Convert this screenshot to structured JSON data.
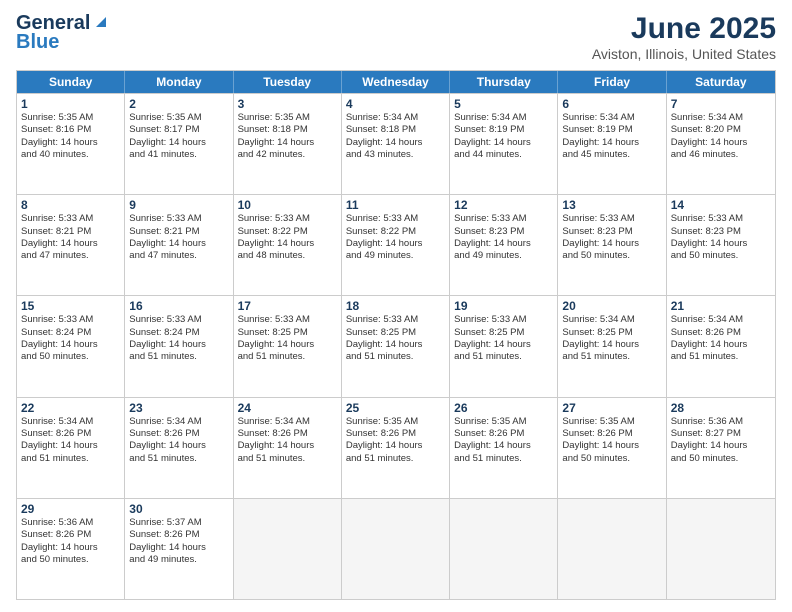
{
  "logo": {
    "general": "General",
    "blue": "Blue"
  },
  "header": {
    "title": "June 2025",
    "subtitle": "Aviston, Illinois, United States"
  },
  "weekdays": [
    "Sunday",
    "Monday",
    "Tuesday",
    "Wednesday",
    "Thursday",
    "Friday",
    "Saturday"
  ],
  "rows": [
    [
      {
        "day": "1",
        "info": "Sunrise: 5:35 AM\nSunset: 8:16 PM\nDaylight: 14 hours\nand 40 minutes."
      },
      {
        "day": "2",
        "info": "Sunrise: 5:35 AM\nSunset: 8:17 PM\nDaylight: 14 hours\nand 41 minutes."
      },
      {
        "day": "3",
        "info": "Sunrise: 5:35 AM\nSunset: 8:18 PM\nDaylight: 14 hours\nand 42 minutes."
      },
      {
        "day": "4",
        "info": "Sunrise: 5:34 AM\nSunset: 8:18 PM\nDaylight: 14 hours\nand 43 minutes."
      },
      {
        "day": "5",
        "info": "Sunrise: 5:34 AM\nSunset: 8:19 PM\nDaylight: 14 hours\nand 44 minutes."
      },
      {
        "day": "6",
        "info": "Sunrise: 5:34 AM\nSunset: 8:19 PM\nDaylight: 14 hours\nand 45 minutes."
      },
      {
        "day": "7",
        "info": "Sunrise: 5:34 AM\nSunset: 8:20 PM\nDaylight: 14 hours\nand 46 minutes."
      }
    ],
    [
      {
        "day": "8",
        "info": "Sunrise: 5:33 AM\nSunset: 8:21 PM\nDaylight: 14 hours\nand 47 minutes."
      },
      {
        "day": "9",
        "info": "Sunrise: 5:33 AM\nSunset: 8:21 PM\nDaylight: 14 hours\nand 47 minutes."
      },
      {
        "day": "10",
        "info": "Sunrise: 5:33 AM\nSunset: 8:22 PM\nDaylight: 14 hours\nand 48 minutes."
      },
      {
        "day": "11",
        "info": "Sunrise: 5:33 AM\nSunset: 8:22 PM\nDaylight: 14 hours\nand 49 minutes."
      },
      {
        "day": "12",
        "info": "Sunrise: 5:33 AM\nSunset: 8:23 PM\nDaylight: 14 hours\nand 49 minutes."
      },
      {
        "day": "13",
        "info": "Sunrise: 5:33 AM\nSunset: 8:23 PM\nDaylight: 14 hours\nand 50 minutes."
      },
      {
        "day": "14",
        "info": "Sunrise: 5:33 AM\nSunset: 8:23 PM\nDaylight: 14 hours\nand 50 minutes."
      }
    ],
    [
      {
        "day": "15",
        "info": "Sunrise: 5:33 AM\nSunset: 8:24 PM\nDaylight: 14 hours\nand 50 minutes."
      },
      {
        "day": "16",
        "info": "Sunrise: 5:33 AM\nSunset: 8:24 PM\nDaylight: 14 hours\nand 51 minutes."
      },
      {
        "day": "17",
        "info": "Sunrise: 5:33 AM\nSunset: 8:25 PM\nDaylight: 14 hours\nand 51 minutes."
      },
      {
        "day": "18",
        "info": "Sunrise: 5:33 AM\nSunset: 8:25 PM\nDaylight: 14 hours\nand 51 minutes."
      },
      {
        "day": "19",
        "info": "Sunrise: 5:33 AM\nSunset: 8:25 PM\nDaylight: 14 hours\nand 51 minutes."
      },
      {
        "day": "20",
        "info": "Sunrise: 5:34 AM\nSunset: 8:25 PM\nDaylight: 14 hours\nand 51 minutes."
      },
      {
        "day": "21",
        "info": "Sunrise: 5:34 AM\nSunset: 8:26 PM\nDaylight: 14 hours\nand 51 minutes."
      }
    ],
    [
      {
        "day": "22",
        "info": "Sunrise: 5:34 AM\nSunset: 8:26 PM\nDaylight: 14 hours\nand 51 minutes."
      },
      {
        "day": "23",
        "info": "Sunrise: 5:34 AM\nSunset: 8:26 PM\nDaylight: 14 hours\nand 51 minutes."
      },
      {
        "day": "24",
        "info": "Sunrise: 5:34 AM\nSunset: 8:26 PM\nDaylight: 14 hours\nand 51 minutes."
      },
      {
        "day": "25",
        "info": "Sunrise: 5:35 AM\nSunset: 8:26 PM\nDaylight: 14 hours\nand 51 minutes."
      },
      {
        "day": "26",
        "info": "Sunrise: 5:35 AM\nSunset: 8:26 PM\nDaylight: 14 hours\nand 51 minutes."
      },
      {
        "day": "27",
        "info": "Sunrise: 5:35 AM\nSunset: 8:26 PM\nDaylight: 14 hours\nand 50 minutes."
      },
      {
        "day": "28",
        "info": "Sunrise: 5:36 AM\nSunset: 8:27 PM\nDaylight: 14 hours\nand 50 minutes."
      }
    ],
    [
      {
        "day": "29",
        "info": "Sunrise: 5:36 AM\nSunset: 8:26 PM\nDaylight: 14 hours\nand 50 minutes."
      },
      {
        "day": "30",
        "info": "Sunrise: 5:37 AM\nSunset: 8:26 PM\nDaylight: 14 hours\nand 49 minutes."
      },
      {
        "day": "",
        "info": ""
      },
      {
        "day": "",
        "info": ""
      },
      {
        "day": "",
        "info": ""
      },
      {
        "day": "",
        "info": ""
      },
      {
        "day": "",
        "info": ""
      }
    ]
  ]
}
